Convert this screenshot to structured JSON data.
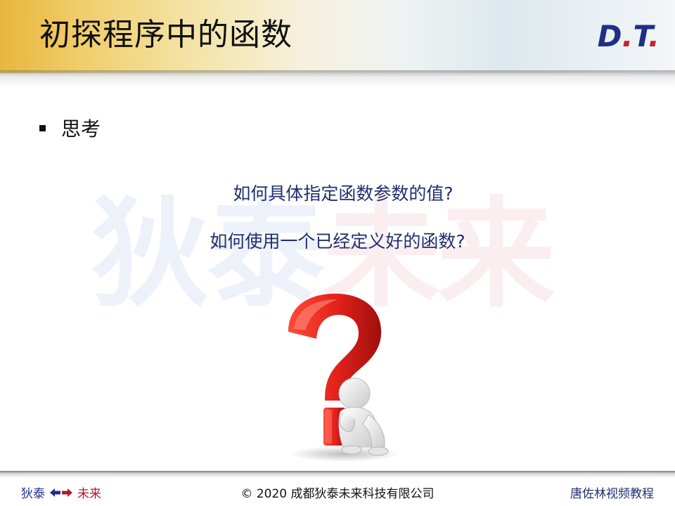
{
  "slide": {
    "title": "初探程序中的函数",
    "logo": {
      "d": "D",
      "dot1": ".",
      "t": "T",
      "dot2": "."
    },
    "watermark": {
      "part1": "狄泰",
      "part2": "未来"
    },
    "bullet": "思考",
    "questions": [
      "如何具体指定函数参数的值?",
      "如何使用一个已经定义好的函数?"
    ],
    "illustration_icon": "question-mark-thinking-person-icon"
  },
  "footer": {
    "left_part1": "狄泰",
    "left_part2": "未来",
    "arrow_icon": "double-arrow-icon",
    "center": "© 2020 成都狄泰未来科技有限公司",
    "right": "唐佐林视频教程"
  },
  "colors": {
    "title_text": "#111111",
    "question_text": "#1f2f6e",
    "brand_blue": "#1f2f86",
    "brand_red": "#c8202a",
    "header_gold": "#e8b63c"
  }
}
